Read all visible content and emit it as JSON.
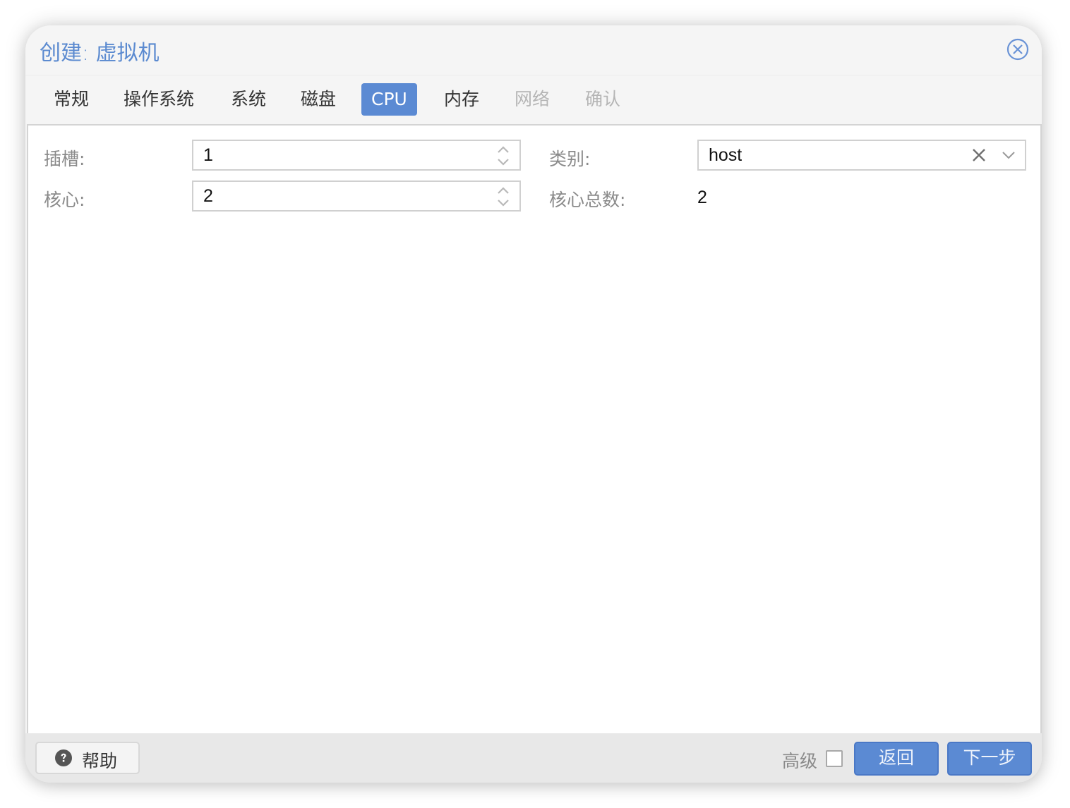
{
  "window": {
    "title": "创建: 虚拟机",
    "close_icon": "circle-x-icon"
  },
  "tabs": [
    {
      "label": "常规",
      "state": "normal"
    },
    {
      "label": "操作系统",
      "state": "normal"
    },
    {
      "label": "系统",
      "state": "normal"
    },
    {
      "label": "磁盘",
      "state": "normal"
    },
    {
      "label": "CPU",
      "state": "active"
    },
    {
      "label": "内存",
      "state": "normal"
    },
    {
      "label": "网络",
      "state": "disabled"
    },
    {
      "label": "确认",
      "state": "disabled"
    }
  ],
  "form": {
    "sockets": {
      "label": "插槽:",
      "value": "1"
    },
    "cores": {
      "label": "核心:",
      "value": "2"
    },
    "type": {
      "label": "类别:",
      "value": "host"
    },
    "total_cores": {
      "label": "核心总数:",
      "value": "2"
    }
  },
  "footer": {
    "help_label": "帮助",
    "advanced_label": "高级",
    "advanced_checked": false,
    "back_label": "返回",
    "next_label": "下一步"
  },
  "colors": {
    "accent": "#5b8ad3",
    "title": "#5b8ad0",
    "disabled_tab": "#b5b5b5",
    "label": "#8a8a8a"
  }
}
